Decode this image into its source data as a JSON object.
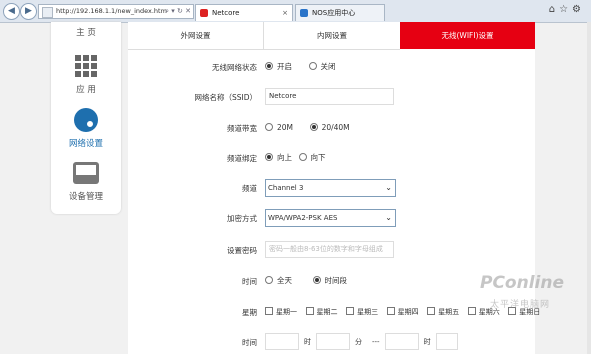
{
  "browser": {
    "url": "http://192.168.1.1/new_index.htm",
    "tabs": [
      {
        "label": "Netcore",
        "icon": "netcore-favicon-icon",
        "active": true
      },
      {
        "label": "NOS应用中心",
        "icon": "nos-favicon-icon",
        "active": false
      }
    ],
    "close_glyph": "×"
  },
  "sidebar": {
    "items": [
      {
        "label": "主 页",
        "icon": "home-icon"
      },
      {
        "label": "应 用",
        "icon": "apps-grid-icon"
      },
      {
        "label": "网络设置",
        "icon": "network-settings-icon",
        "active": true
      },
      {
        "label": "设备管理",
        "icon": "device-management-icon"
      }
    ]
  },
  "tabs": [
    {
      "label": "外网设置"
    },
    {
      "label": "内网设置"
    },
    {
      "label": "无线(WIFI)设置",
      "active": true
    }
  ],
  "form": {
    "wireless_status": {
      "label": "无线网络状态",
      "options": [
        "开启",
        "关闭"
      ],
      "selected": "开启"
    },
    "ssid": {
      "label": "网络名称（SSID）",
      "value": "Netcore"
    },
    "bandwidth": {
      "label": "频道带宽",
      "options": [
        "20M",
        "20/40M"
      ],
      "selected": "20/40M"
    },
    "channel_bind": {
      "label": "频道绑定",
      "options": [
        "向上",
        "向下"
      ],
      "selected": "向上"
    },
    "channel": {
      "label": "频道",
      "value": "Channel 3"
    },
    "encryption": {
      "label": "加密方式",
      "value": "WPA/WPA2-PSK AES"
    },
    "password": {
      "label": "设置密码",
      "placeholder": "密码一般由8-63位的数字和字母组成"
    },
    "time": {
      "label": "时间",
      "options": [
        "全天",
        "时间段"
      ],
      "selected": "时间段"
    },
    "weekdays": {
      "label": "星期",
      "days": [
        "星期一",
        "星期二",
        "星期三",
        "星期四",
        "星期五",
        "星期六",
        "星期日"
      ]
    },
    "time_range": {
      "label": "时间",
      "hour": "时",
      "minute": "分",
      "dash": "---"
    }
  },
  "watermark": {
    "brand": "PConline",
    "cn": "太平洋电脑网"
  },
  "colors": {
    "accent": "#e60012",
    "active_blue": "#1e6fae"
  }
}
